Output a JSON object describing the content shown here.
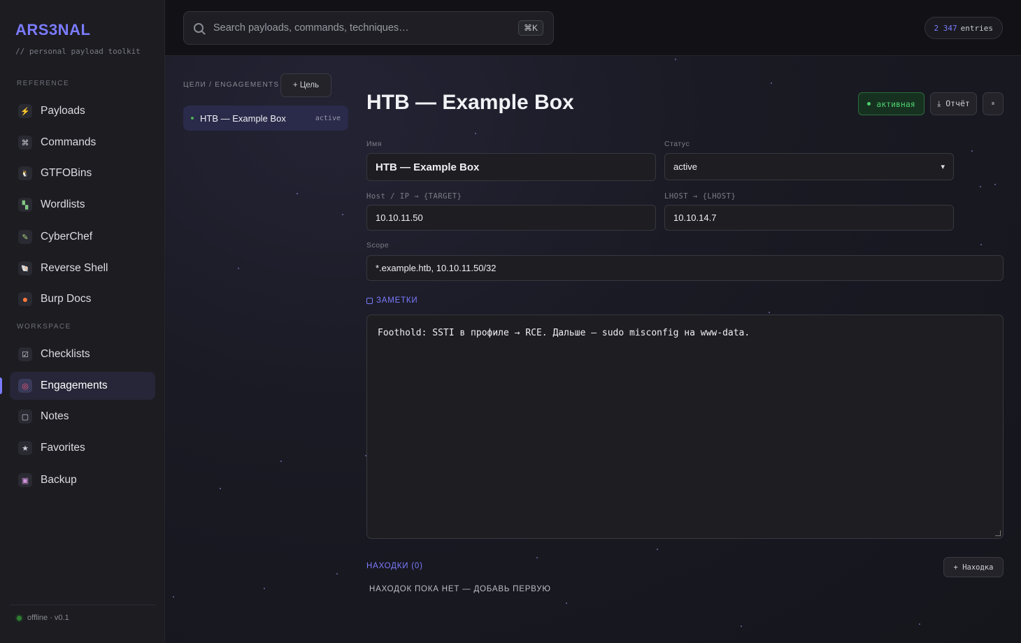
{
  "brand": {
    "name": "ARS3NAL",
    "tagline": "// personal payload toolkit"
  },
  "sidebar": {
    "reference_label": "REFERENCE",
    "workspace_label": "WORKSPACE",
    "reference": [
      {
        "label": "Payloads",
        "icon": "⚡"
      },
      {
        "label": "Commands",
        "icon": "⌘"
      },
      {
        "label": "GTFOBins",
        "icon": "🐧"
      },
      {
        "label": "Wordlists",
        "icon": "▚"
      },
      {
        "label": "CyberChef",
        "icon": "✎"
      },
      {
        "label": "Reverse Shell",
        "icon": "🐚"
      },
      {
        "label": "Burp Docs",
        "icon": "●"
      }
    ],
    "workspace": [
      {
        "label": "Checklists",
        "icon": "☑"
      },
      {
        "label": "Engagements",
        "icon": "◎"
      },
      {
        "label": "Notes",
        "icon": "▢"
      },
      {
        "label": "Favorites",
        "icon": "★"
      },
      {
        "label": "Backup",
        "icon": "▣"
      }
    ],
    "status": "offline · v0.1"
  },
  "topbar": {
    "search_placeholder": "Search payloads, commands, techniques…",
    "shortcut": "⌘K",
    "entries_count": "2 347",
    "entries_label": "entries"
  },
  "engagements": {
    "label": "ЦЕЛИ / ENGAGEMENTS",
    "add_button": "+ Цель",
    "list": [
      {
        "name": "HTB — Example Box",
        "badge": "active"
      }
    ]
  },
  "detail": {
    "title": "HTB — Example Box",
    "status_pill": "активная",
    "report_button": "⤓ Отчёт",
    "delete_button": "⏸",
    "name_label": "Имя",
    "name_value": "HTB — Example Box",
    "status_label": "Статус",
    "status_value": "active",
    "host_label": "Host / IP → {TARGET}",
    "host_value": "10.10.11.50",
    "lhost_label": "LHOST → {LHOST}",
    "lhost_value": "10.10.14.7",
    "scope_label": "Scope",
    "scope_value": "*.example.htb, 10.10.11.50/32",
    "notes_label": "ЗАМЕТКИ",
    "notes_value": "Foothold: SSTI в профиле → RCE. Дальше — sudo misconfig на www-data.",
    "findings_label": "НАХОДКИ (0)",
    "add_finding": "+ Находка",
    "empty_findings": "НАХОДОК ПОКА НЕТ — ДОБАВЬ ПЕРВУЮ"
  },
  "colors": {
    "accent": "#7b7bff",
    "active_green": "#4cd070",
    "sidebar_bg": "#1c1c21"
  }
}
